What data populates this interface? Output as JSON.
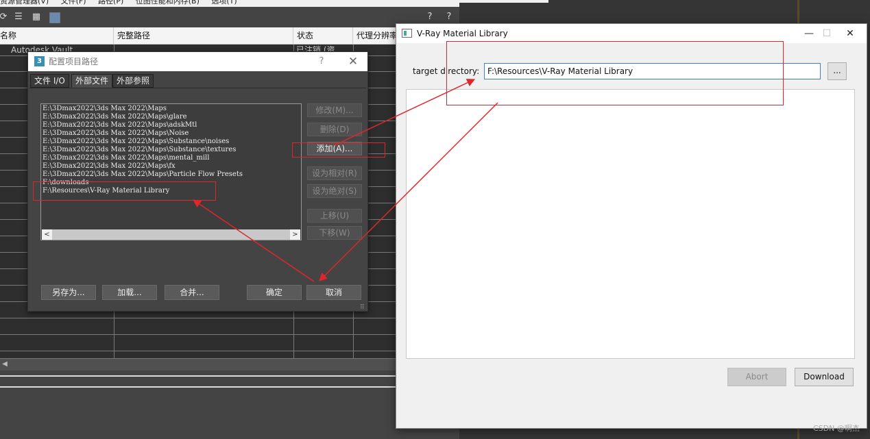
{
  "background_window": {
    "menu": [
      "资源管理器(V)",
      "文件(F)",
      "路径(P)",
      "位图性能和内存(B)",
      "选项(T)"
    ],
    "columns": [
      "名称",
      "完整路径",
      "状态",
      "代理分辨率"
    ],
    "first_row": {
      "name": "Autodesk Vault",
      "status": "已注销 (资"
    }
  },
  "config_dialog": {
    "app_icon": "3",
    "title": "配置项目路径",
    "help": "?",
    "close": "✕",
    "tabs": [
      "文件 I/O",
      "外部文件",
      "外部参照"
    ],
    "active_tab": "外部文件",
    "paths": [
      "E:\\3Dmax2022\\3ds Max 2022\\Maps",
      "E:\\3Dmax2022\\3ds Max 2022\\Maps\\glare",
      "E:\\3Dmax2022\\3ds Max 2022\\Maps\\adskMtl",
      "E:\\3Dmax2022\\3ds Max 2022\\Maps\\Noise",
      "E:\\3Dmax2022\\3ds Max 2022\\Maps\\Substance\\noises",
      "E:\\3Dmax2022\\3ds Max 2022\\Maps\\Substance\\textures",
      "E:\\3Dmax2022\\3ds Max 2022\\Maps\\mental_mill",
      "E:\\3Dmax2022\\3ds Max 2022\\Maps\\fx",
      "E:\\3Dmax2022\\3ds Max 2022\\Maps\\Particle Flow Presets",
      "F:\\downloads",
      "F:\\Resources\\V-Ray Material Library"
    ],
    "side_buttons": {
      "modify": "修改(M)...",
      "delete": "删除(D)",
      "add": "添加(A)...",
      "make_relative": "设为相对(R)",
      "make_absolute": "设为绝对(S)",
      "move_up": "上移(U)",
      "move_down": "下移(W)"
    },
    "footer_buttons": {
      "save_as": "另存为...",
      "load": "加载...",
      "merge": "合并...",
      "ok": "确定",
      "cancel": "取消"
    }
  },
  "vray_window": {
    "title": "V-Ray Material Library",
    "target_label": "target directory:",
    "target_value": "F:\\Resources\\V-Ray Material Library",
    "browse_label": "...",
    "abort_label": "Abort",
    "download_label": "Download",
    "minimize": "—",
    "maximize": "☐",
    "close": "✕"
  },
  "annotation_color": "#e0262b",
  "watermark": "CSDN @啊杰"
}
